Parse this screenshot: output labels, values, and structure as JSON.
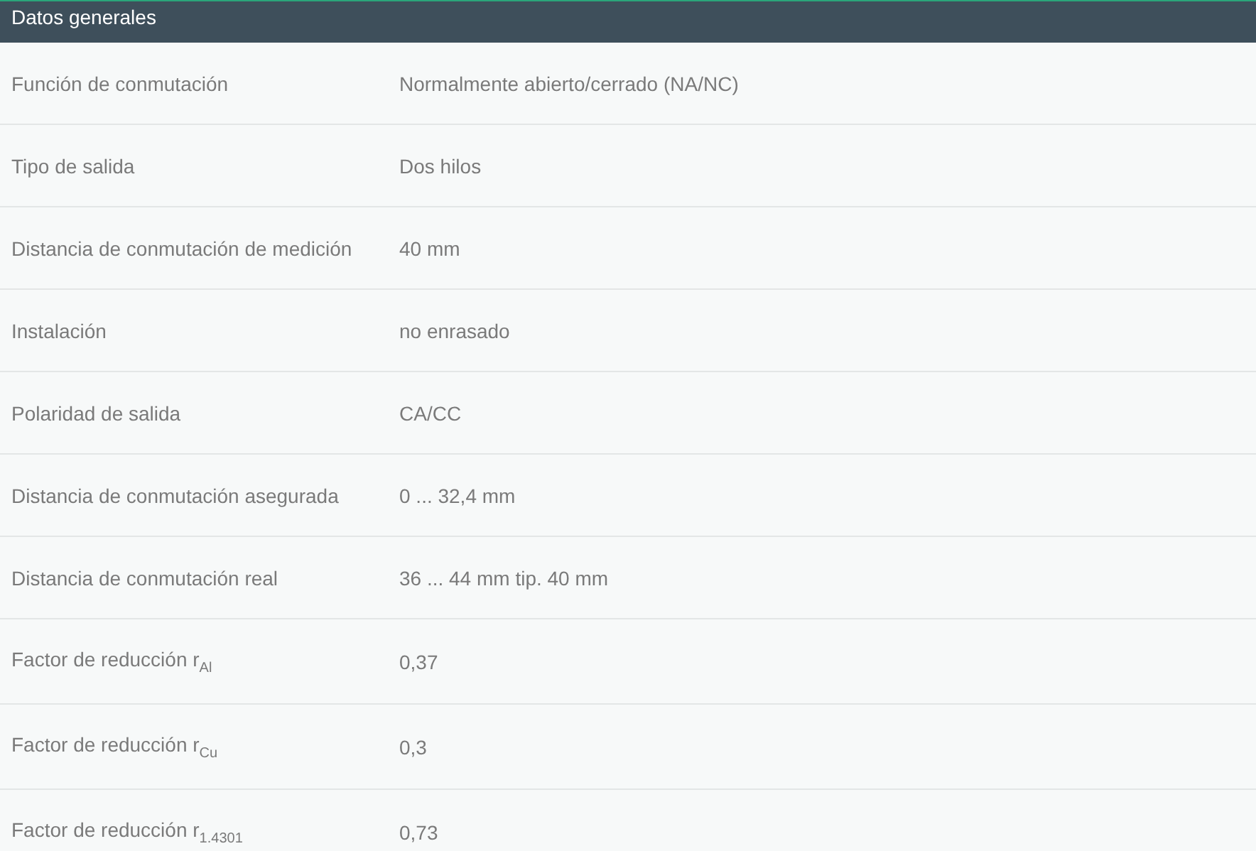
{
  "section": {
    "title": "Datos generales"
  },
  "rows": [
    {
      "label": "Función de conmutación",
      "value": "Normalmente abierto/cerrado (NA/NC)"
    },
    {
      "label": "Tipo de salida",
      "value": "Dos hilos"
    },
    {
      "label": "Distancia de conmutación de medición",
      "value": "40 mm"
    },
    {
      "label": "Instalación",
      "value": "no enrasado"
    },
    {
      "label": "Polaridad de salida",
      "value": "CA/CC"
    },
    {
      "label": "Distancia de conmutación asegurada",
      "value": "0 ... 32,4 mm"
    },
    {
      "label": "Distancia de conmutación real",
      "value": "36 ... 44 mm tip. 40 mm"
    },
    {
      "label": "Factor de reducción r$_{Al}$",
      "value": "0,37"
    },
    {
      "label": "Factor de reducción r$_{Cu}$",
      "value": "0,3"
    },
    {
      "label": "Factor de reducción r$_{1.4301}$",
      "value": "0,73"
    }
  ]
}
